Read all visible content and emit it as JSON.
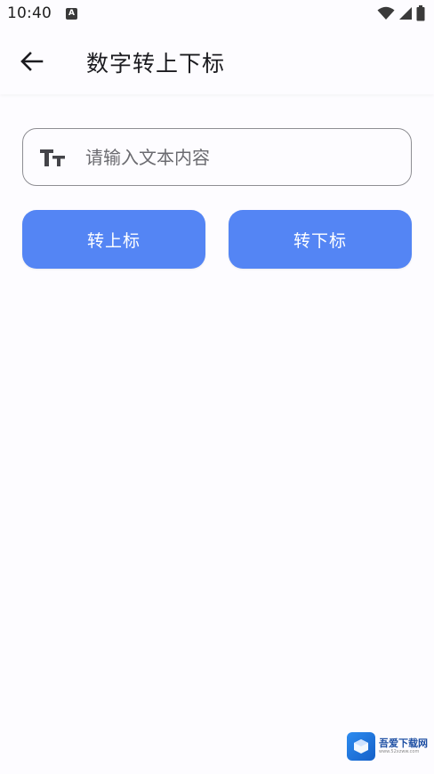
{
  "status_bar": {
    "time": "10:40",
    "notification_badge": "A"
  },
  "app_bar": {
    "title": "数字转上下标",
    "back_icon": "arrow-back-icon"
  },
  "input": {
    "placeholder": "请输入文本内容",
    "value": "",
    "leading_icon": "text-size-icon"
  },
  "buttons": {
    "superscript_label": "转上标",
    "subscript_label": "转下标"
  },
  "watermark": {
    "text": "吾爱下载网",
    "url": "www.52xzww.com"
  },
  "colors": {
    "primary": "#5485f4",
    "background": "#fdfcff",
    "outline": "#8e8e93"
  }
}
